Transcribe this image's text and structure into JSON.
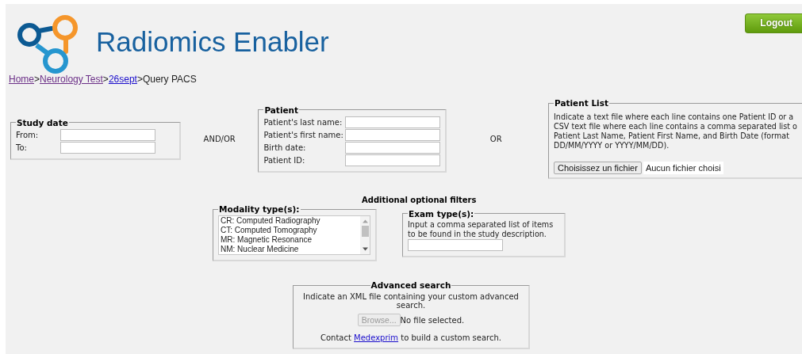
{
  "header": {
    "title": "Radiomics Enabler",
    "logout": "Logout"
  },
  "breadcrumb": {
    "separator": ">",
    "items": [
      {
        "label": "Home",
        "kind": "visited"
      },
      {
        "label": "Neurology Test",
        "kind": "visited"
      },
      {
        "label": "26sept",
        "kind": "link"
      },
      {
        "label": "Query PACS",
        "kind": "current"
      }
    ]
  },
  "study_date": {
    "legend": "Study date",
    "fields": [
      {
        "label": "From:"
      },
      {
        "label": "To:"
      }
    ]
  },
  "and_or": "AND/OR",
  "patient": {
    "legend": "Patient",
    "fields": [
      {
        "label": "Patient's last name:"
      },
      {
        "label": "Patient's first name:"
      },
      {
        "label": "Birth date:"
      },
      {
        "label": "Patient ID:"
      }
    ]
  },
  "or": "OR",
  "patient_list": {
    "legend": "Patient List",
    "description_lines": [
      "Indicate a text file where each line contains one Patient ID or a",
      "CSV text file where each line contains a comma separated list o",
      "Patient Last Name, Patient First Name, and Birth Date (format",
      "DD/MM/YYYY or YYYY/MM/DD)."
    ],
    "file_button": "Choisissez un fichier",
    "file_status": "Aucun fichier choisi"
  },
  "filters_heading": "Additional optional filters",
  "modality": {
    "legend": "Modality type(s):",
    "options": [
      {
        "label": "CR: Computed Radiography",
        "selected": false
      },
      {
        "label": "CT: Computed Tomography",
        "selected": false
      },
      {
        "label": "MR: Magnetic Resonance",
        "selected": false
      },
      {
        "label": "NM: Nuclear Medicine",
        "selected": false
      }
    ]
  },
  "exam": {
    "legend": "Exam type(s):",
    "description": "Input a comma separated list of items to be found in the study description."
  },
  "advanced": {
    "legend": "Advanced search",
    "description": "Indicate an XML file containing your custom advanced search.",
    "browse_button": "Browse...",
    "browse_disabled": true,
    "file_status": "No file selected.",
    "contact_before": "Contact",
    "contact_link": "Medexprim",
    "contact_after": "to build a custom search."
  }
}
